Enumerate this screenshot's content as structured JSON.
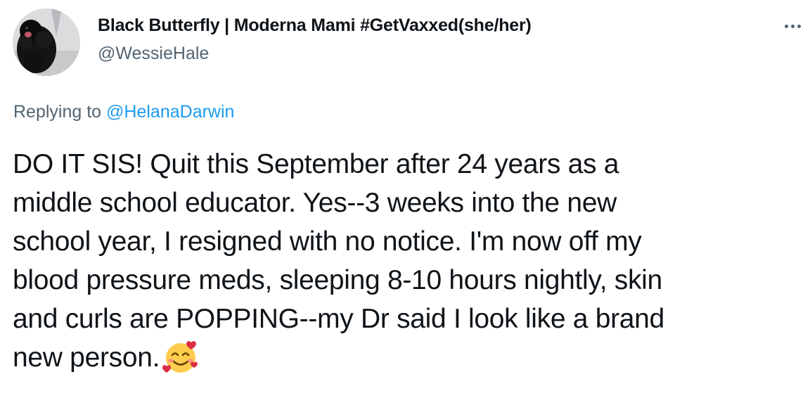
{
  "tweet": {
    "author": {
      "display_name": "Black Butterfly | Moderna Mami #GetVaxxed(she/her)",
      "handle": "@WessieHale",
      "avatar_icon": "dog-avatar-icon"
    },
    "more_icon": "more-options-icon",
    "replying": {
      "prefix": "Replying to ",
      "mention": "@HelanaDarwin"
    },
    "text_lines": [
      "DO IT SIS! Quit this September after 24 years as a",
      "middle school educator. Yes--3 weeks into the new",
      "school year, I resigned with no notice. I'm now off my",
      "blood pressure meds, sleeping 8-10 hours nightly, skin",
      "and curls are POPPING--my Dr said I look like a brand",
      "new person."
    ],
    "end_emoji": "smiling-face-with-hearts-icon"
  },
  "colors": {
    "text": "#0f1419",
    "secondary": "#536471",
    "link": "#1d9bf0",
    "background": "#ffffff"
  }
}
